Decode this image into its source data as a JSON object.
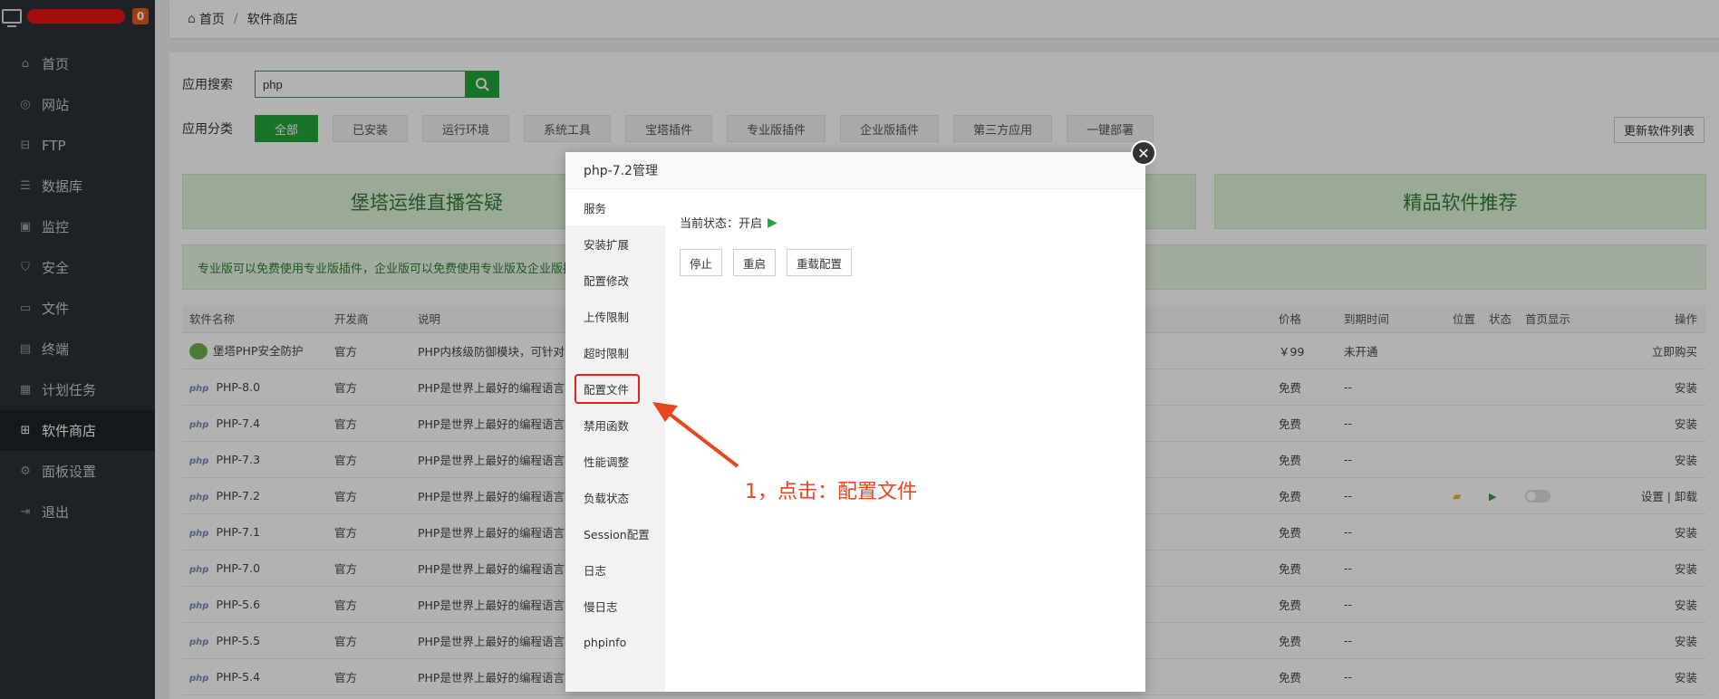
{
  "sidebar": {
    "badge": "0",
    "items": [
      {
        "label": "首页",
        "icon": "home-icon"
      },
      {
        "label": "网站",
        "icon": "globe-icon"
      },
      {
        "label": "FTP",
        "icon": "ftp-icon"
      },
      {
        "label": "数据库",
        "icon": "database-icon"
      },
      {
        "label": "监控",
        "icon": "monitor-icon"
      },
      {
        "label": "安全",
        "icon": "shield-icon"
      },
      {
        "label": "文件",
        "icon": "folder-icon"
      },
      {
        "label": "终端",
        "icon": "terminal-icon"
      },
      {
        "label": "计划任务",
        "icon": "calendar-icon"
      },
      {
        "label": "软件商店",
        "icon": "grid-icon"
      },
      {
        "label": "面板设置",
        "icon": "gear-icon"
      },
      {
        "label": "退出",
        "icon": "logout-icon"
      }
    ],
    "active_index": 9
  },
  "breadcrumb": {
    "home": "首页",
    "sep": "/",
    "current": "软件商店"
  },
  "search": {
    "label": "应用搜索",
    "value": "php"
  },
  "categories": {
    "label": "应用分类",
    "items": [
      "全部",
      "已安装",
      "运行环境",
      "系统工具",
      "宝塔插件",
      "专业版插件",
      "企业版插件",
      "第三方应用",
      "一键部署"
    ],
    "active_index": 0,
    "update_button": "更新软件列表"
  },
  "banners": {
    "left": "堡塔运维直播答疑",
    "right": "精品软件推荐"
  },
  "notice": "专业版可以免费使用专业版插件，企业版可以免费使用专业版及企业版插件",
  "table": {
    "headers": {
      "name": "软件名称",
      "dev": "开发商",
      "desc": "说明",
      "price": "价格",
      "expire": "到期时间",
      "pos": "位置",
      "status": "状态",
      "home": "首页显示",
      "action": "操作"
    },
    "rows": [
      {
        "name": "堡塔PHP安全防护",
        "dev": "官方",
        "desc": "PHP内核级防御模块，可针对",
        "price": "￥99",
        "expire": "未开通",
        "action": "立即购买"
      },
      {
        "name": "PHP-8.0",
        "dev": "官方",
        "desc": "PHP是世界上最好的编程语言",
        "price": "免费",
        "expire": "--",
        "action": "安装"
      },
      {
        "name": "PHP-7.4",
        "dev": "官方",
        "desc": "PHP是世界上最好的编程语言",
        "price": "免费",
        "expire": "--",
        "action": "安装"
      },
      {
        "name": "PHP-7.3",
        "dev": "官方",
        "desc": "PHP是世界上最好的编程语言",
        "price": "免费",
        "expire": "--",
        "action": "安装"
      },
      {
        "name": "PHP-7.2",
        "dev": "官方",
        "desc": "PHP是世界上最好的编程语言",
        "price": "免费",
        "expire": "--",
        "action": "设置 | 卸载"
      },
      {
        "name": "PHP-7.1",
        "dev": "官方",
        "desc": "PHP是世界上最好的编程语言",
        "price": "免费",
        "expire": "--",
        "action": "安装"
      },
      {
        "name": "PHP-7.0",
        "dev": "官方",
        "desc": "PHP是世界上最好的编程语言",
        "price": "免费",
        "expire": "--",
        "action": "安装"
      },
      {
        "name": "PHP-5.6",
        "dev": "官方",
        "desc": "PHP是世界上最好的编程语言",
        "price": "免费",
        "expire": "--",
        "action": "安装"
      },
      {
        "name": "PHP-5.5",
        "dev": "官方",
        "desc": "PHP是世界上最好的编程语言",
        "price": "免费",
        "expire": "--",
        "action": "安装"
      },
      {
        "name": "PHP-5.4",
        "dev": "官方",
        "desc": "PHP是世界上最好的编程语言",
        "price": "免费",
        "expire": "--",
        "action": "安装"
      }
    ],
    "php_logo": "php"
  },
  "modal": {
    "title": "php-7.2管理",
    "menu": [
      "服务",
      "安装扩展",
      "配置修改",
      "上传限制",
      "超时限制",
      "配置文件",
      "禁用函数",
      "性能调整",
      "负载状态",
      "Session配置",
      "日志",
      "慢日志",
      "phpinfo"
    ],
    "active_index": 0,
    "highlight_index": 5,
    "status_label": "当前状态：开启",
    "buttons": [
      "停止",
      "重启",
      "重载配置"
    ]
  },
  "annotation": {
    "text": "1，点击：配置文件",
    "color": "#e8461e"
  },
  "colors": {
    "accent": "#20a53a",
    "sidebar": "#2b3035",
    "highlight": "#e0241b"
  }
}
